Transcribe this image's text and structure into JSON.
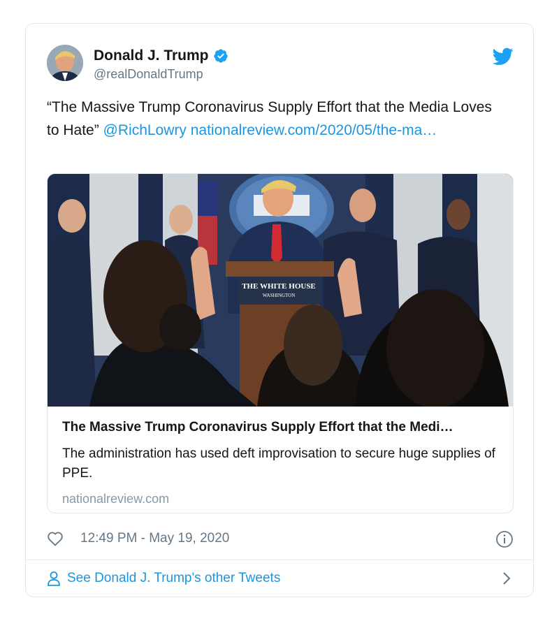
{
  "tweet": {
    "author_name": "Donald J. Trump",
    "author_handle": "@realDonaldTrump",
    "text_quote": "“The Massive Trump Coronavirus Supply Effort that the Media Loves to Hate” ",
    "mention": "@RichLowry",
    "url_part": " nationalreview.com/2020/05/the-ma…",
    "timestamp": "12:49 PM - May 19, 2020",
    "icons": [
      "verified-badge-icon",
      "twitter-bird-icon",
      "heart-icon",
      "info-icon",
      "person-icon",
      "chevron-right-icon"
    ]
  },
  "card": {
    "title": "The Massive Trump Coronavirus Supply Effort that the Medi…",
    "description": "The administration has used deft improvisation to secure huge supplies of PPE.",
    "domain": "nationalreview.com",
    "podium_line1": "THE WHITE HOUSE",
    "podium_line2": "WASHINGTON"
  },
  "footer": {
    "more_tweets_label": "See Donald J. Trump's other Tweets"
  },
  "colors": {
    "link": "#1b95e0",
    "secondary_text": "#657786",
    "border": "#e1e8ed"
  }
}
